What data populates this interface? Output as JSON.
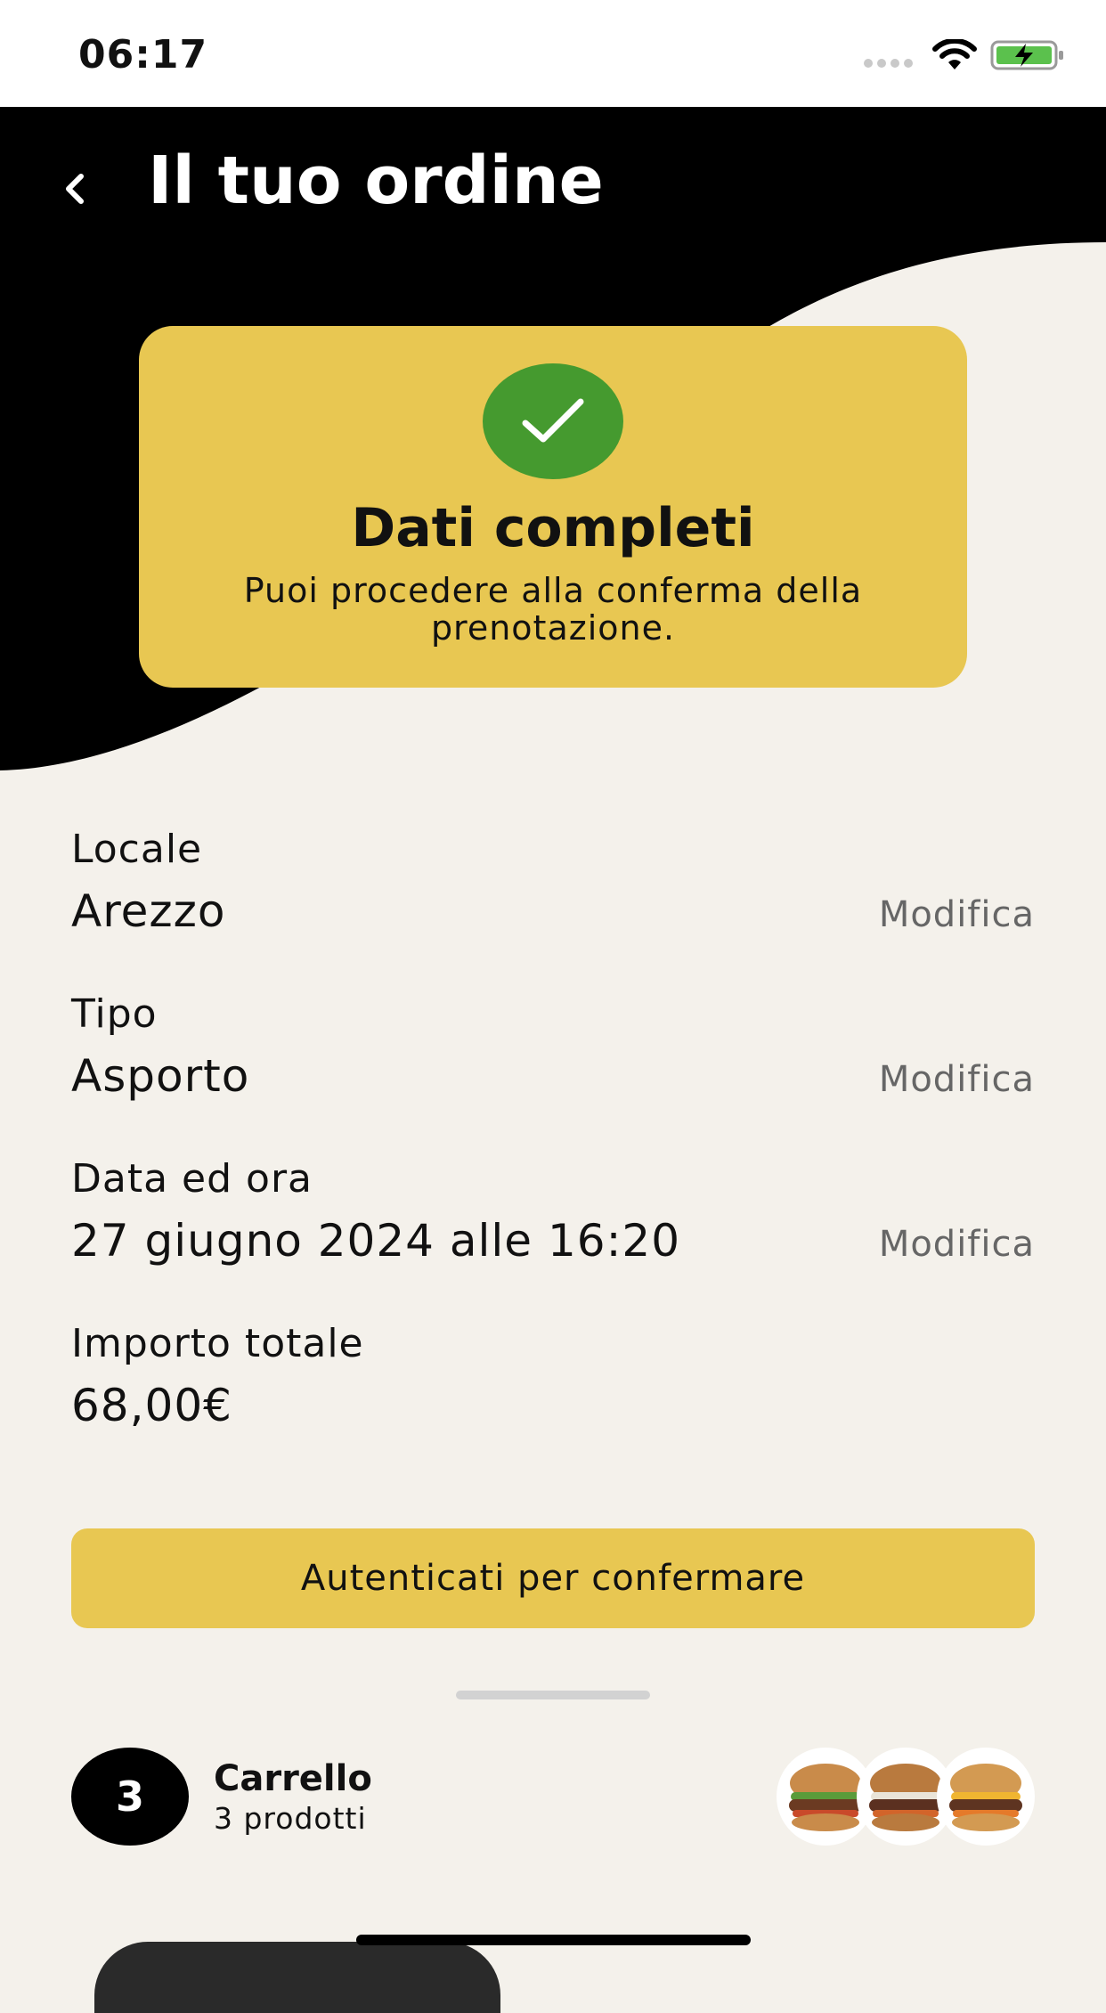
{
  "status_bar": {
    "time": "06:17"
  },
  "header": {
    "title": "Il tuo ordine"
  },
  "status_card": {
    "title": "Dati completi",
    "subtitle": "Puoi procedere alla conferma della prenotazione."
  },
  "details": [
    {
      "label": "Locale",
      "value": "Arezzo",
      "edit_label": "Modifica"
    },
    {
      "label": "Tipo",
      "value": "Asporto",
      "edit_label": "Modifica"
    },
    {
      "label": "Data ed ora",
      "value": "27 giugno 2024 alle 16:20",
      "edit_label": "Modifica"
    },
    {
      "label": "Importo totale",
      "value": "68,00€"
    }
  ],
  "cta": {
    "label": "Autenticati per confermare"
  },
  "cart": {
    "count": "3",
    "title": "Carrello",
    "subtitle": "3 prodotti"
  },
  "colors": {
    "accent": "#e8c752",
    "success": "#459a2f",
    "background": "#f4f1eb",
    "header": "#000000"
  }
}
